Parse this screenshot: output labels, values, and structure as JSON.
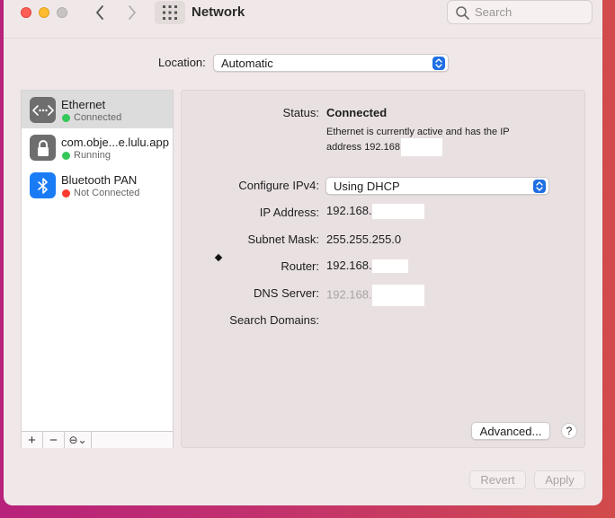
{
  "window": {
    "title": "Network",
    "search_placeholder": "Search"
  },
  "location": {
    "label": "Location:",
    "value": "Automatic"
  },
  "services": [
    {
      "name": "Ethernet",
      "status": "Connected",
      "status_color": "#34c759",
      "icon": "ethernet-icon",
      "selected": true
    },
    {
      "name": "com.obje...e.lulu.app",
      "status": "Running",
      "status_color": "#34c759",
      "icon": "lock-icon",
      "selected": false
    },
    {
      "name": "Bluetooth PAN",
      "status": "Not Connected",
      "status_color": "#ff3b30",
      "icon": "bluetooth-icon",
      "selected": false
    }
  ],
  "service_toolbar": {
    "add": "+",
    "remove": "−",
    "action": "⊖⌄"
  },
  "detail": {
    "status_label": "Status:",
    "status_value": "Connected",
    "status_desc": "Ethernet is currently active and has the IP address 192.168",
    "ipv4_label": "Configure IPv4:",
    "ipv4_value": "Using DHCP",
    "ip_label": "IP Address:",
    "ip_value": "192.168.",
    "subnet_label": "Subnet Mask:",
    "subnet_value": "255.255.255.0",
    "router_label": "Router:",
    "router_value": "192.168.",
    "dns_label": "DNS Server:",
    "dns_value": "192.168.",
    "search_domains_label": "Search Domains:",
    "advanced_button": "Advanced...",
    "help_button": "?"
  },
  "footer": {
    "revert": "Revert",
    "apply": "Apply"
  },
  "colors": {
    "accent": "#1f6fe4",
    "connected": "#34c759",
    "disconnected": "#ff3b30"
  }
}
